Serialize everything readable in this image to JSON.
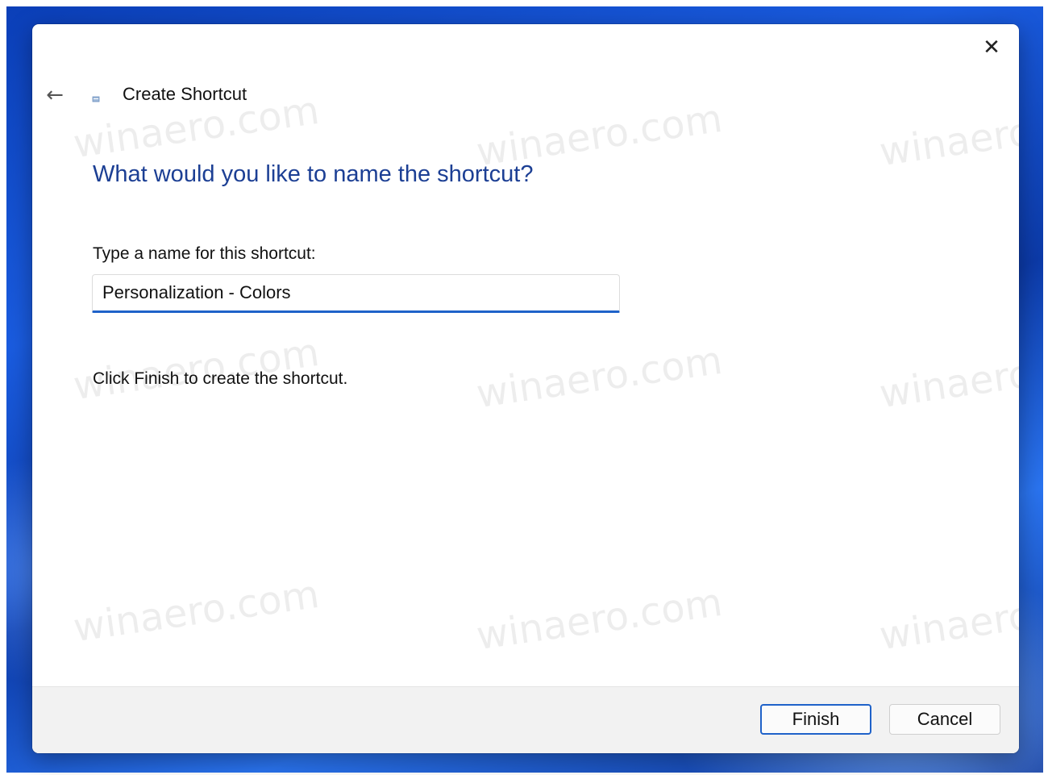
{
  "window": {
    "title": "Create Shortcut",
    "close_glyph": "✕",
    "back_glyph": "←"
  },
  "page": {
    "heading": "What would you like to name the shortcut?",
    "field_label": "Type a name for this shortcut:",
    "input_value": "Personalization - Colors",
    "hint": "Click Finish to create the shortcut."
  },
  "footer": {
    "finish_label": "Finish",
    "cancel_label": "Cancel"
  },
  "watermark": "winaero.com",
  "icons": {
    "close": "close-icon",
    "back": "arrow-left-icon",
    "wizard": "shortcut-wizard-icon"
  },
  "colors": {
    "accent": "#1f62c9",
    "heading": "#1c3f94"
  }
}
